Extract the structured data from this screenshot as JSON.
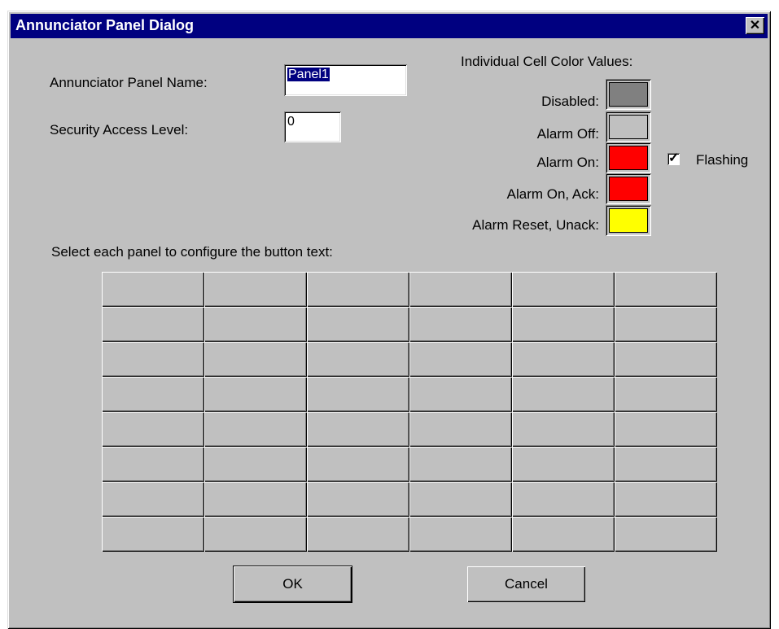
{
  "window": {
    "title": "Annunciator Panel Dialog",
    "close_glyph": "✕"
  },
  "form": {
    "panel_name": {
      "label": "Annunciator Panel Name:",
      "value": "Panel1"
    },
    "security": {
      "label": "Security Access Level:",
      "value": "0"
    }
  },
  "colors": {
    "heading": "Individual Cell Color Values:",
    "items": [
      {
        "label": "Disabled:",
        "color": "#808080"
      },
      {
        "label": "Alarm Off:",
        "color": "#c0c0c0"
      },
      {
        "label": "Alarm On:",
        "color": "#ff0000"
      },
      {
        "label": "Alarm On, Ack:",
        "color": "#ff0000"
      },
      {
        "label": "Alarm Reset, Unack:",
        "color": "#ffff00"
      }
    ],
    "flashing": {
      "label": "Flashing",
      "checked": true
    }
  },
  "panel_grid": {
    "instruction": "Select each panel to configure the button text:",
    "rows": 8,
    "cols": 6
  },
  "buttons": {
    "ok": "OK",
    "cancel": "Cancel"
  }
}
